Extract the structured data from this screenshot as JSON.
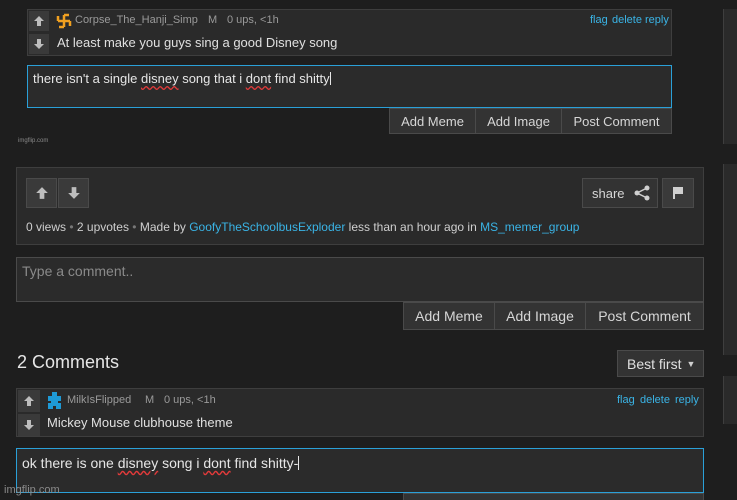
{
  "reply1": {
    "username": "Corpse_The_Hanji_Simp",
    "badge": "M",
    "meta": "0 ups, <1h",
    "text": "At least make you guys sing a good Disney song",
    "actions": [
      "flag",
      "delete",
      "reply"
    ],
    "avatar_icon": "pinwheel-icon",
    "avatar_color": "#f0a020"
  },
  "reply1_box": {
    "text_parts": [
      "there isn't a single ",
      "disney",
      " song that i ",
      "dont",
      " find shitty"
    ]
  },
  "reply1_buttons": {
    "add_meme": "Add Meme",
    "add_image": "Add Image",
    "post_comment": "Post Comment"
  },
  "watermark_small": "imgflip.com",
  "post_panel": {
    "share_label": "share",
    "views": "0 views",
    "upvotes": "2 upvotes",
    "made_by_prefix": "Made by",
    "author": "GoofyTheSchoolbusExploder",
    "time_text": "less than an hour ago in",
    "stream": "MS_memer_group"
  },
  "comment_box": {
    "placeholder": "Type a comment..",
    "add_meme": "Add Meme",
    "add_image": "Add Image",
    "post_comment": "Post Comment"
  },
  "comments_header": {
    "count_label": "2 Comments",
    "sort_label": "Best first"
  },
  "comment2": {
    "username": "MilkIsFlipped",
    "badge": "M",
    "meta": "0 ups, <1h",
    "text": "Mickey Mouse clubhouse theme",
    "actions": [
      "flag",
      "delete",
      "reply"
    ],
    "avatar_icon": "puzzle-icon",
    "avatar_color": "#1e9ad6"
  },
  "reply2_box": {
    "text_parts": [
      "ok there is one ",
      "disney",
      " song i ",
      "dont",
      " find shitty-"
    ]
  },
  "watermark_large": "imgflip.com"
}
